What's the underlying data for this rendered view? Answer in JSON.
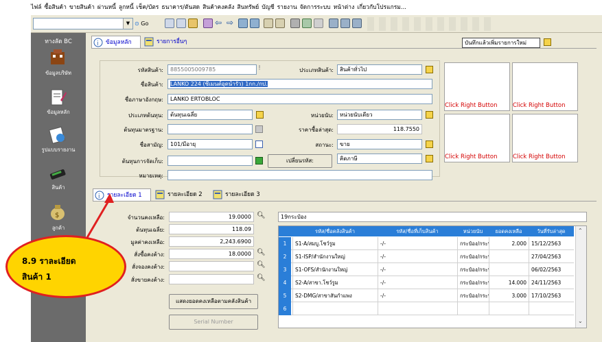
{
  "menu": [
    "ไฟล์",
    "ซื้อสินค้า",
    "ขายสินค้า",
    "ผ่านหนี้",
    "ลูกหนี้",
    "เช็ค/บัตร",
    "ธนาคาร/ตันสด",
    "สินค้าคงคลัง",
    "สินทรัพย์",
    "บัญชี",
    "รายงาน",
    "จัดการระบบ",
    "หน้าต่าง",
    "เกี่ยวกับโปรแกรม..."
  ],
  "toolbar": {
    "go_label": "Go"
  },
  "sidebar": {
    "title": "ทางลัด BC",
    "items": [
      "ข้อมูลบริษัท",
      "ข้อมูลหลัก",
      "รูปแบบรายงาน",
      "สินค้า",
      "ลูกค้า"
    ]
  },
  "tabs_top": [
    "ข้อมูลหลัก",
    "รายการอื่นๆ"
  ],
  "save_mode": "บันทึกแล้วเพิ่มรายการใหม่",
  "form": {
    "code_label": "รหัสสินค้า:",
    "code": "8855005009785",
    "name_label": "ชื่อสินค้า:",
    "name": "LANKO 224 (ซีเมนต์อุดน้ำรั่ว) 1กก./กป.",
    "eng_label": "ชื่อภาษาอังกฤษ:",
    "eng": "LANKO ERTOBLOC",
    "costtype_label": "ประเภทต้นทุน:",
    "costtype": "ต้นทุนเฉลี่ย",
    "stdcost_label": "ต้นทุนมาตรฐาน:",
    "stdcost": "",
    "common_label": "ชื่อสามัญ:",
    "common": "101/มีอายุ",
    "storecost_label": "ต้นทุนการจัดเก็บ:",
    "storecost": "",
    "note_label": "หมายเหตุ:",
    "note": "",
    "type_label": "ประเภทสินค้า:",
    "type": "สินค้าทั่วไป",
    "unit_label": "หน่วยนับ:",
    "unit": "หน่วยนับเดียว",
    "lastprice_label": "ราคาซื้อล่าสุด:",
    "lastprice": "118.7550",
    "status_label": "สถานะ:",
    "status": "ขาย",
    "change_code_btn": "เปลี่ยนรหัส:",
    "tax": "คิดภาษี"
  },
  "pictures": [
    "Click Right Button",
    "Click Right Button",
    "Click Right Button",
    "Click Right Button"
  ],
  "tabs_detail": [
    "รายละเอียด 1",
    "รายละเอียด 2",
    "รายละเอียด 3"
  ],
  "detail": {
    "remain_label": "จำนวนคงเหลือ:",
    "remain": "19.0000",
    "avgcost_label": "ต้นทุนเฉลี่ย:",
    "avgcost": "118.09",
    "value_label": "มูลค่าคงเหลือ:",
    "value": "2,243.6900",
    "po_label": "สั่งซื้อคงค้าง:",
    "po": "18.0000",
    "reserve_label": "สั่งจองคงค้าง:",
    "reserve": "",
    "so_label": "สั่งขายคงค้าง:",
    "so": "",
    "show_stock_btn": "แสดงยอดคงเหลือตามคลังสินค้า",
    "serial_btn": "Serial Number"
  },
  "stock_summary": "19กระป๋อง",
  "stock_table": {
    "headers": [
      "รหัส/ชื่อคลังสินค้า",
      "รหัส/ชื่อที่เก็บสินค้า",
      "หน่วยนับ",
      "ยอดคงเหลือ",
      "วันที่รับล่าสุด"
    ],
    "rows": [
      {
        "no": "1",
        "wh": "S1-A/สมบู.โชว์รูม",
        "loc": "-/-",
        "unit": "กระป๋อง/กระป",
        "qty": "2.000",
        "date": "15/12/2563"
      },
      {
        "no": "2",
        "wh": "S1-ISP/สำนักงานใหญ่",
        "loc": "-/-",
        "unit": "กระป๋อง/กระป",
        "qty": "",
        "date": "27/04/2563"
      },
      {
        "no": "3",
        "wh": "S1-OFS/สำนักงานใหญ่",
        "loc": "-/-",
        "unit": "กระป๋อง/กระป",
        "qty": "",
        "date": "06/02/2563"
      },
      {
        "no": "4",
        "wh": "S2-A/สาขา.โชว์รูม",
        "loc": "-/-",
        "unit": "กระป๋อง/กระป",
        "qty": "14.000",
        "date": "24/11/2563"
      },
      {
        "no": "5",
        "wh": "S2-DMG/สาขาสันกำแพง",
        "loc": "-/-",
        "unit": "กระป๋อง/กระป",
        "qty": "3.000",
        "date": "17/10/2563"
      },
      {
        "no": "6",
        "wh": "",
        "loc": "",
        "unit": "",
        "qty": "",
        "date": ""
      }
    ]
  },
  "callout": {
    "line1": "8.9 ราละเอียด",
    "line2": "สินค้า 1",
    "color": "#ffd400",
    "border": "#e02020"
  }
}
